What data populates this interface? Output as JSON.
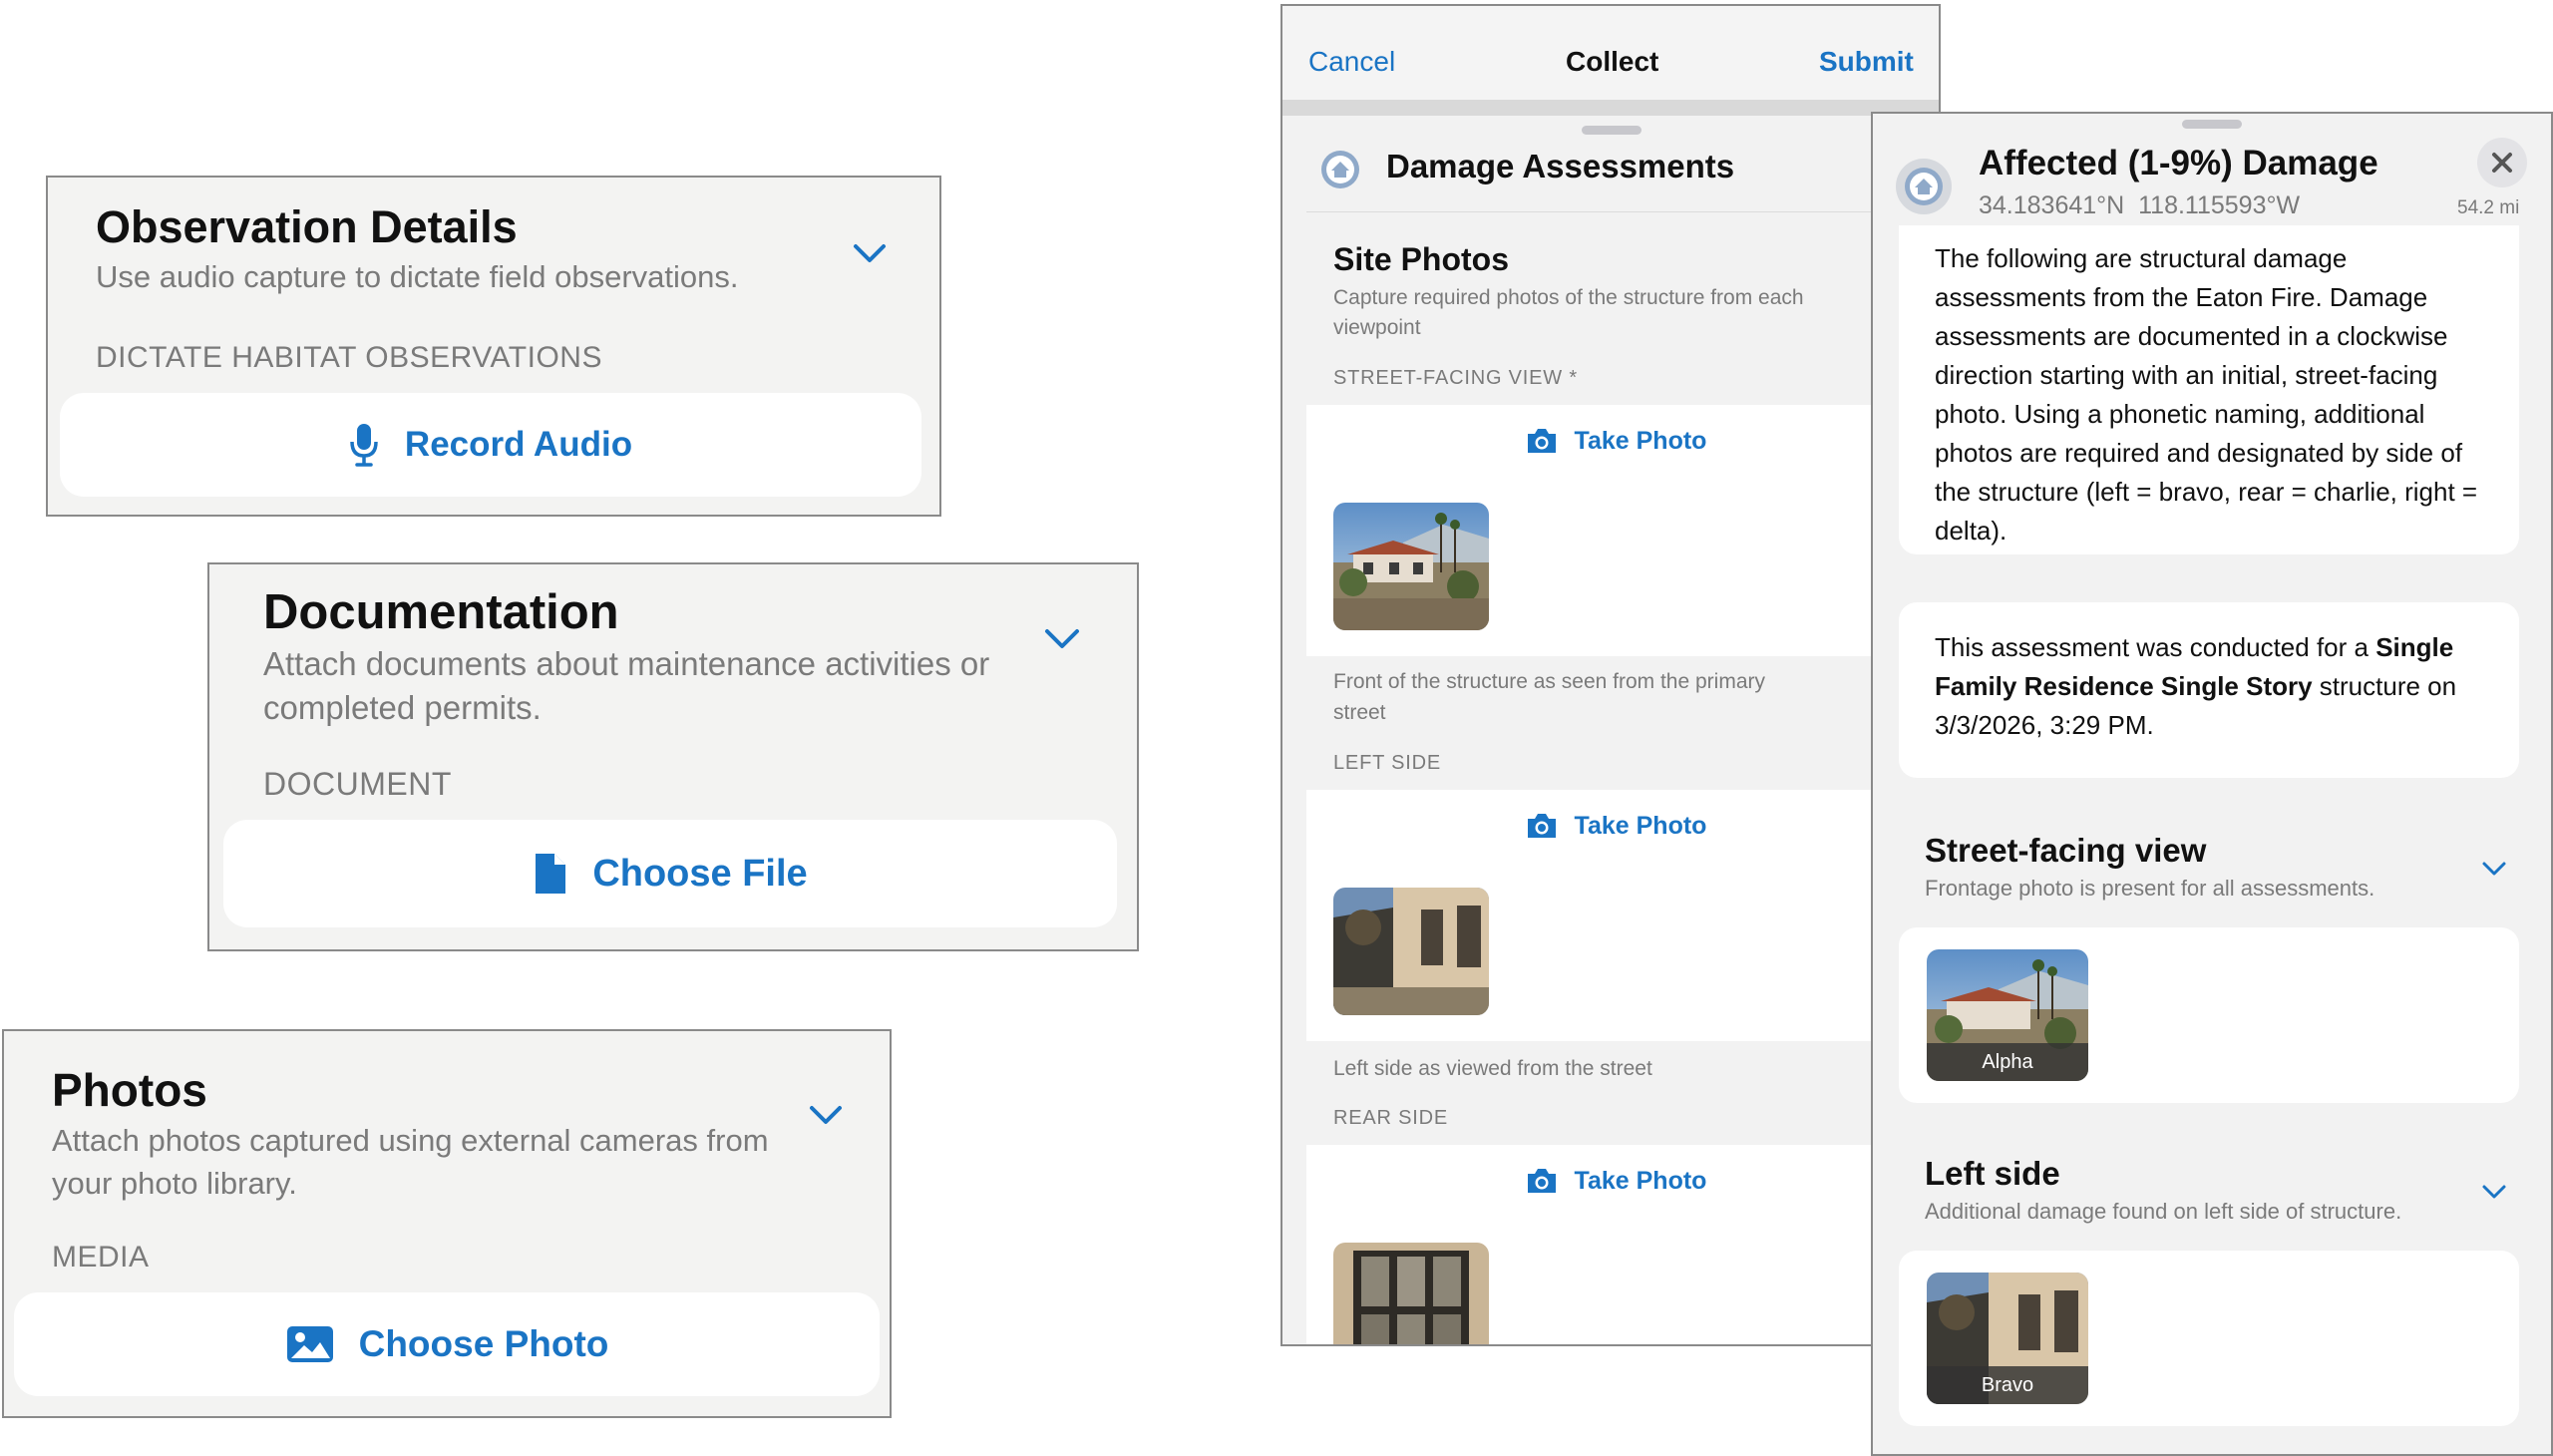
{
  "observation": {
    "title": "Observation Details",
    "subtitle": "Use audio capture to dictate field observations.",
    "label": "DICTATE HABITAT OBSERVATIONS",
    "button": "Record Audio",
    "button_icon": "microphone-icon"
  },
  "documentation": {
    "title": "Documentation",
    "subtitle": "Attach documents about maintenance activities or completed permits.",
    "label": "DOCUMENT",
    "button": "Choose File",
    "button_icon": "document-icon"
  },
  "photos": {
    "title": "Photos",
    "subtitle": "Attach photos captured using external cameras from your photo library.",
    "label": "MEDIA",
    "button": "Choose Photo",
    "button_icon": "photo-icon"
  },
  "collect": {
    "nav": {
      "cancel": "Cancel",
      "title": "Collect",
      "submit": "Submit"
    },
    "layer_title": "Damage Assessments",
    "section_title": "Site Photos",
    "section_subtitle": "Capture required photos of the structure from each viewpoint",
    "fields": [
      {
        "label": "STREET-FACING VIEW *",
        "button": "Take Photo",
        "caption": "Front of the structure as seen from the primary street"
      },
      {
        "label": "LEFT SIDE",
        "button": "Take Photo",
        "caption": "Left side as viewed from the street"
      },
      {
        "label": "REAR SIDE",
        "button": "Take Photo"
      }
    ]
  },
  "popup": {
    "title": "Affected (1-9%) Damage",
    "coords": "34.183641°N  118.115593°W",
    "distance": "54.2 mi",
    "description": "The following are structural damage assessments from the Eaton Fire. Damage assessments are documented in a clockwise direction starting with an initial, street-facing photo. Using a phonetic naming, additional photos are required and designated by side of the structure (left = bravo, rear = charlie, right = delta).",
    "summary_prefix": "This assessment was conducted for a ",
    "summary_bold": "Single Family Residence Single Story",
    "summary_suffix": " structure on 3/3/2026, 3:29 PM.",
    "groups": [
      {
        "title": "Street-facing view",
        "subtitle": "Frontage photo is present for all assessments.",
        "tile": "Alpha"
      },
      {
        "title": "Left side",
        "subtitle": "Additional damage found on left side of structure.",
        "tile": "Bravo"
      }
    ]
  },
  "colors": {
    "accent": "#1a74c4",
    "secondary_text": "#7a7a7a",
    "card_bg": "#f3f3f2"
  }
}
